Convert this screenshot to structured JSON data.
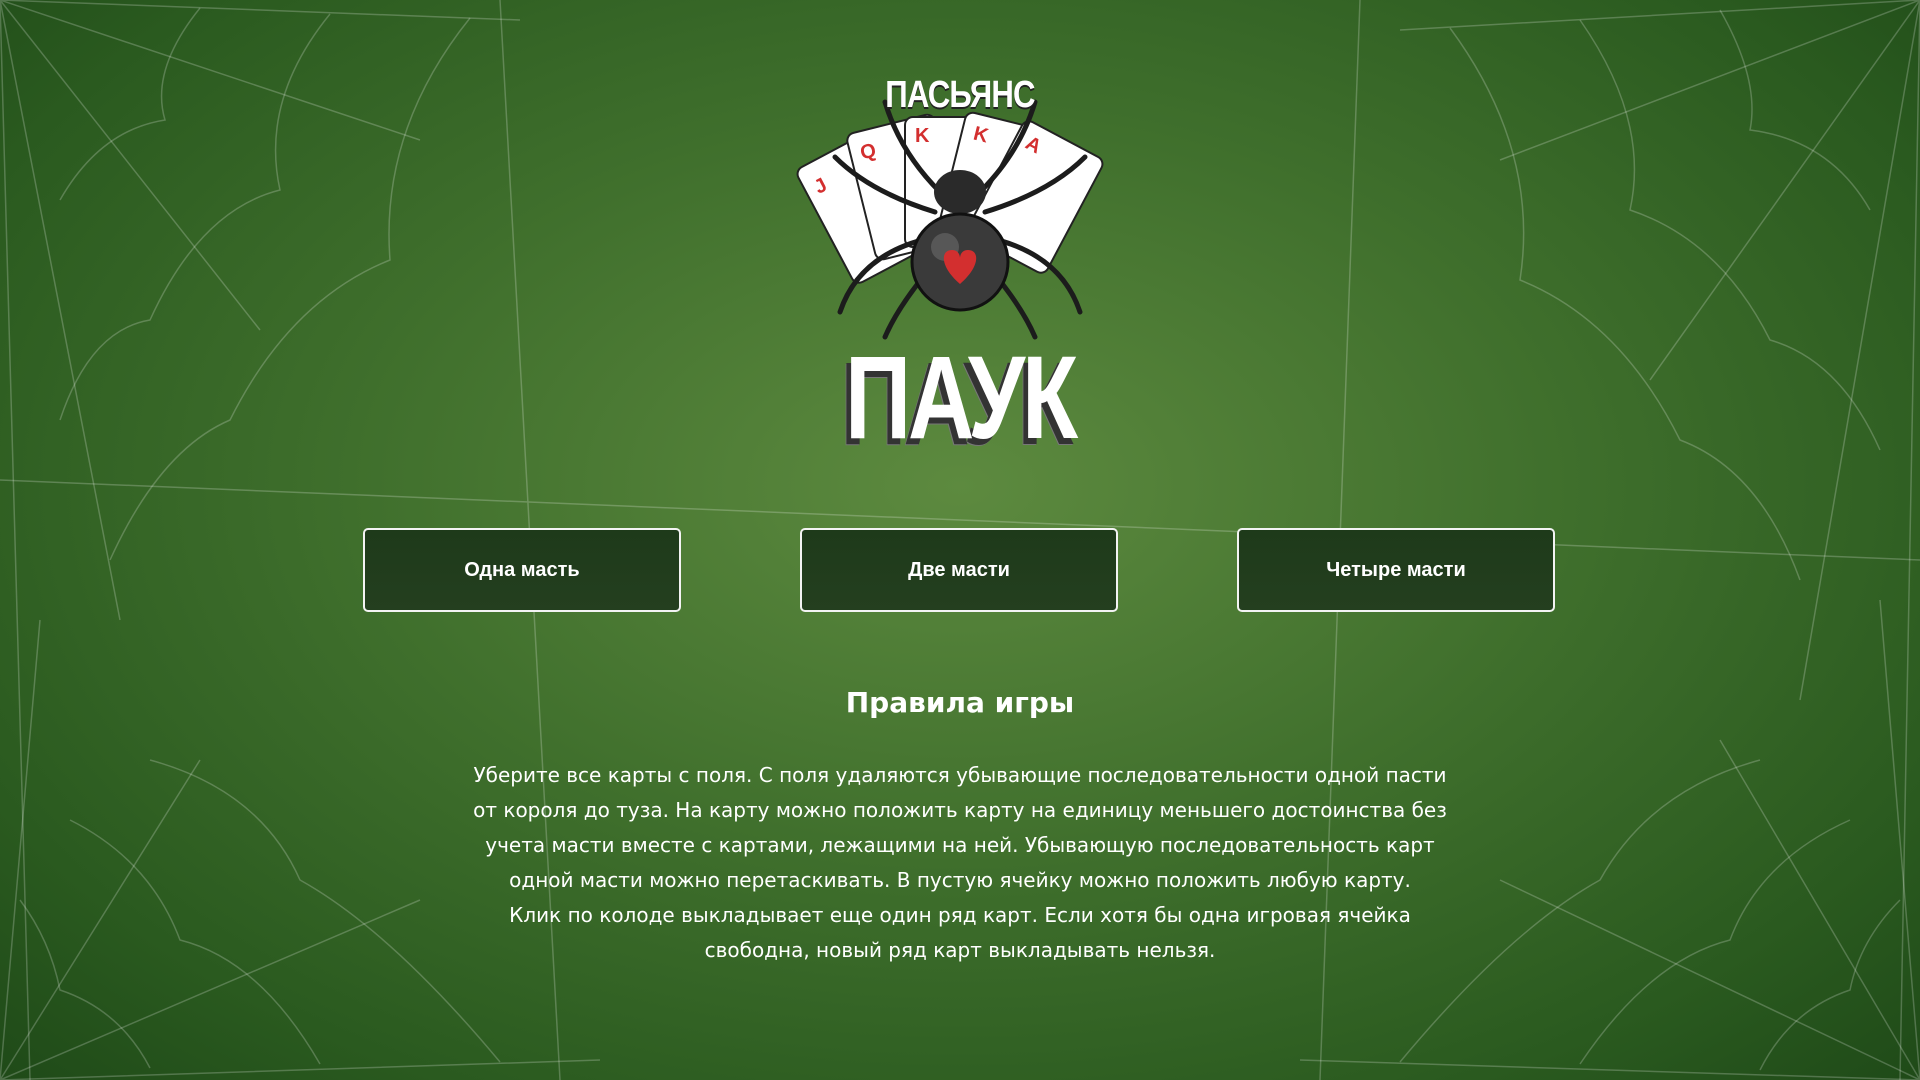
{
  "logo": {
    "top_text": "ПАСЬЯНС",
    "bottom_text": "ПАУК",
    "spider_icon": "spider-icon",
    "cards_icon": "playing-cards-icon"
  },
  "buttons": [
    {
      "label": "Одна масть"
    },
    {
      "label": "Две масти"
    },
    {
      "label": "Четыре масти"
    }
  ],
  "rules": {
    "title": "Правила игры",
    "lines": [
      "Уберите все карты с поля. С поля удаляются убывающие последовательности одной пасти",
      "от короля до туза. На карту можно положить карту на единицу меньшего достоинства без",
      "учета масти вместе с картами, лежащими на ней. Убывающую последовательность карт",
      "одной масти можно перетаскивать. В пустую ячейку можно положить любую карту.",
      "Клик по колоде выкладывает еще один ряд карт. Если хотя бы одна игровая ячейка",
      "свободна, новый ряд карт выкладывать нельзя."
    ]
  },
  "colors": {
    "background": "#4a7a34",
    "button_bg": "#213c1c",
    "button_border": "#f3f3f3",
    "heart_red": "#d32f2f"
  }
}
